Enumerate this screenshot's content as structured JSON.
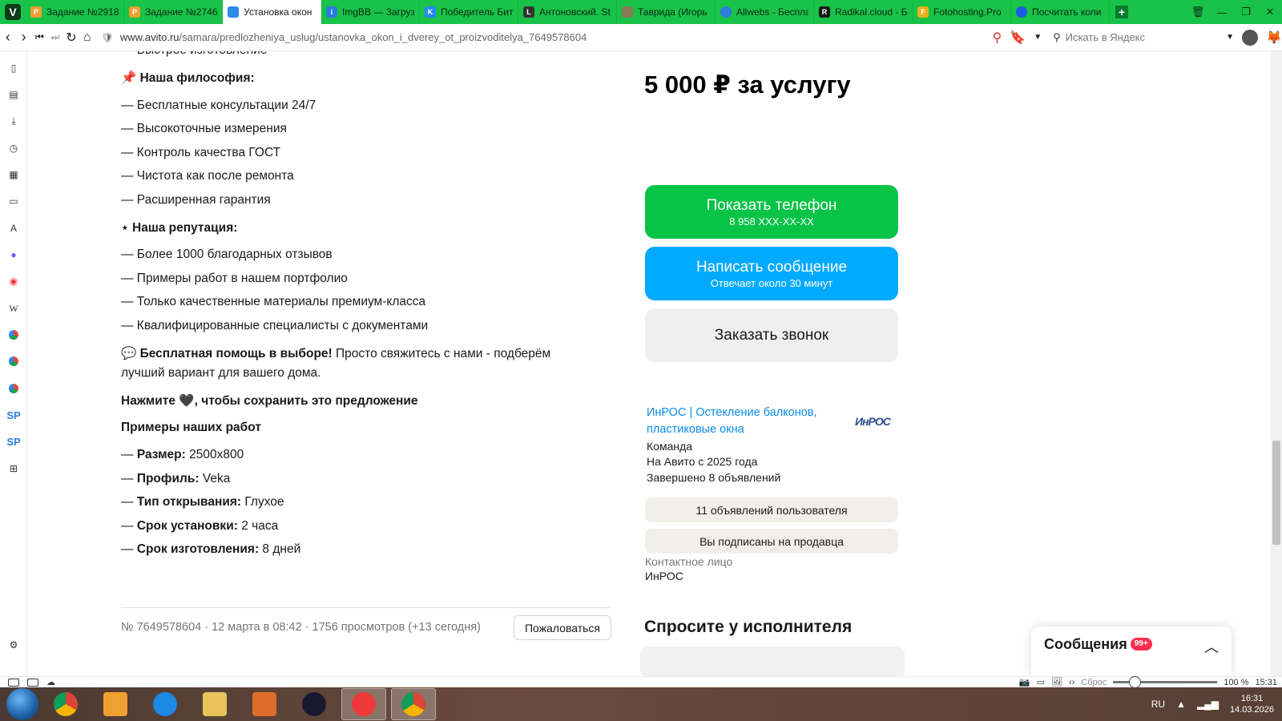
{
  "browser": {
    "tabs": [
      {
        "label": "Задание №2918",
        "favicon_color": "#f0a030",
        "active": false
      },
      {
        "label": "Задание №2746",
        "favicon_color": "#f0a030",
        "active": false
      },
      {
        "label": "Установка окон",
        "favicon_color": "#2d8ae8",
        "active": true
      },
      {
        "label": "ImgBB — Загруз",
        "favicon_color": "#2a7de0",
        "active": false
      },
      {
        "label": "Победитель Бит",
        "favicon_color": "#2787f5",
        "active": false
      },
      {
        "label": "Антоновский. St",
        "favicon_color": "#333333",
        "active": false
      },
      {
        "label": "Таврида (Игорь",
        "favicon_color": "#8a7a5a",
        "active": false
      },
      {
        "label": "Allwebs - Беспла",
        "favicon_color": "#2d7de0",
        "active": false
      },
      {
        "label": "Radikal.cloud - Б",
        "favicon_color": "#1a1a1a",
        "active": false
      },
      {
        "label": "Fotohosting.Pro",
        "favicon_color": "#e8b020",
        "active": false
      },
      {
        "label": "Посчитать коли",
        "favicon_color": "#1a5ae8",
        "active": false
      }
    ],
    "url_host": "www.avito.ru",
    "url_path": "/samara/predlozheniya_uslug/ustanovka_okon_i_dverey_ot_proizvoditelya_7649578604",
    "search_placeholder": "Искать в Яндекс"
  },
  "sidebar_icons": [
    "bookmark-icon",
    "reader-icon",
    "download-icon",
    "history-icon",
    "notes-icon",
    "window-icon",
    "translate-icon",
    "mastodon-icon",
    "vivaldi-icon",
    "wikipedia-icon",
    "webpanel-icon",
    "webpanel-icon",
    "webpanel-icon",
    "sp-icon",
    "sp-icon",
    "add-panel-icon"
  ],
  "description": {
    "top_line": "— Быстрое изготовление",
    "philosophy_title": "📌 Наша философия:",
    "philosophy_items": [
      "— Бесплатные консультации 24/7",
      "— Высокоточные измерения",
      "— Контроль качества ГОСТ",
      "— Чистота как после ремонта",
      "— Расширенная гарантия"
    ],
    "reputation_title": "⋆ Наша репутация:",
    "reputation_items": [
      "— Более 1000 благодарных отзывов",
      "— Примеры работ в нашем портфолио",
      "— Только качественные материалы премиум-класса",
      "— Квалифицированные специалисты с документами"
    ],
    "help_bold": "💬 Бесплатная помощь в выборе!",
    "help_text1": " Просто свяжитесь с нами - подберём",
    "help_text2": "лучший вариант для вашего дома.",
    "save_prompt": "Нажмите 🖤, чтобы сохранить это предложение",
    "examples_title": "Примеры наших работ",
    "specs": [
      {
        "key": "Размер:",
        "value": " 2500x800"
      },
      {
        "key": "Профиль:",
        "value": " Veka"
      },
      {
        "key": "Тип открывания:",
        "value": " Глухое"
      },
      {
        "key": "Срок установки:",
        "value": " 2 часа"
      },
      {
        "key": "Срок изготовления:",
        "value": " 8 дней"
      }
    ]
  },
  "listing": {
    "price": "5 000 ₽ за услугу",
    "show_phone": "Показать телефон",
    "phone_masked": "8 958 XXX-XX-XX",
    "write_message": "Написать сообщение",
    "reply_time": "Отвечает около 30 минут",
    "order_call": "Заказать звонок",
    "seller_name_line1": "ИнРОС | Остекление балконов,",
    "seller_name_line2": "пластиковые окна",
    "seller_type": "Команда",
    "seller_since": "На Авито с 2025 года",
    "seller_completed": "Завершено 8 объявлений",
    "seller_logo": "ИнРОС",
    "user_ads": "11 объявлений пользователя",
    "subscribed": "Вы подписаны на продавца",
    "contact_label": "Контактное лицо",
    "contact_name": "ИнРОС",
    "meta": "№ 7649578604 · 12 марта в 08:42 · 1756 просмотров (+13 сегодня)",
    "report": "Пожаловаться",
    "ask_title": "Спросите у исполнителя"
  },
  "messages": {
    "label": "Сообщения",
    "badge": "99+"
  },
  "statusbar": {
    "reset": "Сброс",
    "zoom": "100 %",
    "time": "15:31"
  },
  "taskbar": {
    "lang": "RU",
    "clock_time": "16:31",
    "clock_date": "14.03.2026"
  },
  "colors": {
    "avito_green": "#07c346",
    "avito_blue": "#00aaff",
    "vivaldi_tabbar": "#19c248",
    "link_blue": "#0a8ce8",
    "badge_red": "#ff2e4d"
  }
}
